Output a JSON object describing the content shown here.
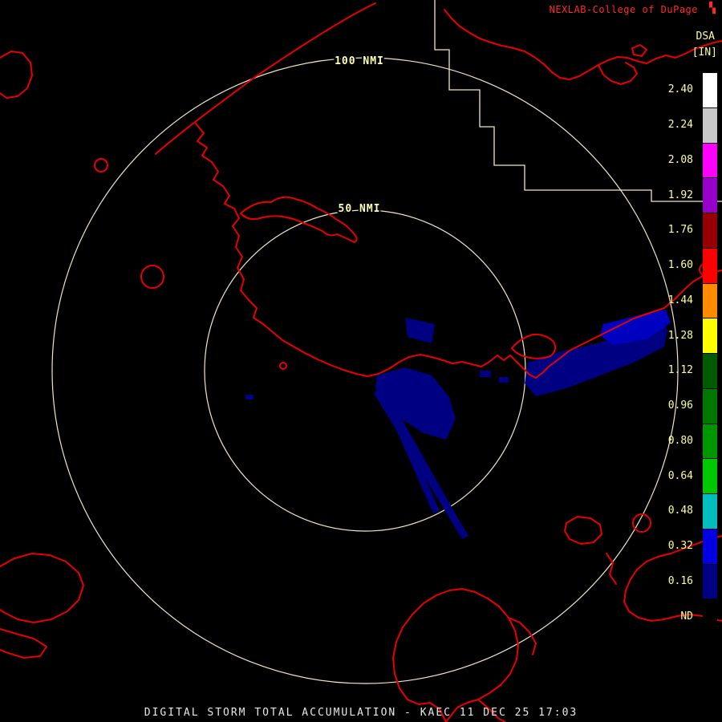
{
  "brand": {
    "text": "NEXLAB-College of DuPage",
    "symbol": "▚"
  },
  "colorbar": {
    "title": "DSA",
    "units": "[IN]",
    "label_color": "#ffff96",
    "entries": [
      {
        "label": "2.40",
        "color": "#FFFFFF"
      },
      {
        "label": "2.24",
        "color": "#C8C8C8"
      },
      {
        "label": "2.08",
        "color": "#FF00FF"
      },
      {
        "label": "1.92",
        "color": "#9600C8"
      },
      {
        "label": "1.76",
        "color": "#960000"
      },
      {
        "label": "1.60",
        "color": "#FF0000"
      },
      {
        "label": "1.44",
        "color": "#FF8C00"
      },
      {
        "label": "1.28",
        "color": "#FFFF00"
      },
      {
        "label": "1.12",
        "color": "#005A00"
      },
      {
        "label": "0.96",
        "color": "#007800"
      },
      {
        "label": "0.80",
        "color": "#009600"
      },
      {
        "label": "0.64",
        "color": "#00C800"
      },
      {
        "label": "0.48",
        "color": "#00BEBE"
      },
      {
        "label": "0.32",
        "color": "#0000E1"
      },
      {
        "label": "0.16",
        "color": "#000082"
      },
      {
        "label": "ND",
        "color": "#000000"
      }
    ]
  },
  "rings": [
    {
      "label": "100 NMI"
    },
    {
      "label": "50 NMI"
    }
  ],
  "map": {
    "boundary_color": "#E60000",
    "ring_color": "#F0E6C8",
    "echo_color": "#000082"
  },
  "footer": {
    "text": "DIGITAL STORM TOTAL ACCUMULATION - KAEC 11 DEC 25 17:03"
  }
}
